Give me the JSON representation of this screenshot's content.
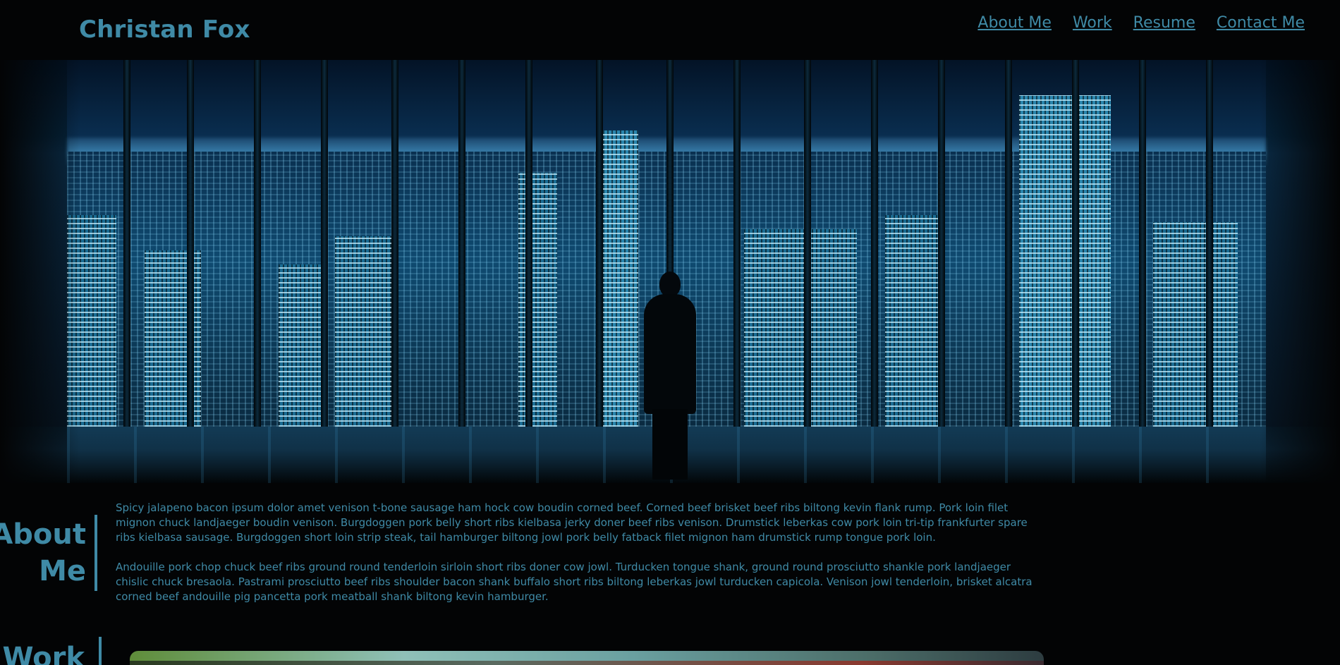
{
  "header": {
    "brand": "Christan Fox",
    "nav": [
      {
        "label": "About Me"
      },
      {
        "label": "Work"
      },
      {
        "label": "Resume"
      },
      {
        "label": "Contact Me"
      }
    ]
  },
  "hero": {
    "image": "night-city-skyline-window"
  },
  "about": {
    "title_line1": "About",
    "title_line2": "Me",
    "paragraphs": [
      "Spicy jalapeno bacon ipsum dolor amet venison t-bone sausage ham hock cow boudin corned beef. Corned beef brisket beef ribs biltong kevin flank rump. Pork loin filet mignon chuck landjaeger boudin venison. Burgdoggen pork belly short ribs kielbasa jerky doner beef ribs venison. Drumstick leberkas cow pork loin tri-tip frankfurter spare ribs kielbasa sausage. Burgdoggen short loin strip steak, tail hamburger biltong jowl pork belly fatback filet mignon ham drumstick rump tongue pork loin.",
      "Andouille pork chop chuck beef ribs ground round tenderloin sirloin short ribs doner cow jowl. Turducken tongue shank, ground round prosciutto shankle pork landjaeger chislic chuck bresaola. Pastrami prosciutto beef ribs shoulder bacon shank buffalo short ribs biltong leberkas jowl turducken capicola. Venison jowl tenderloin, brisket alcatra corned beef andouille pig pancetta pork meatball shank biltong kevin hamburger."
    ]
  },
  "work": {
    "title": "Work"
  },
  "colors": {
    "background": "#030405",
    "accent": "#3f8aa6"
  }
}
